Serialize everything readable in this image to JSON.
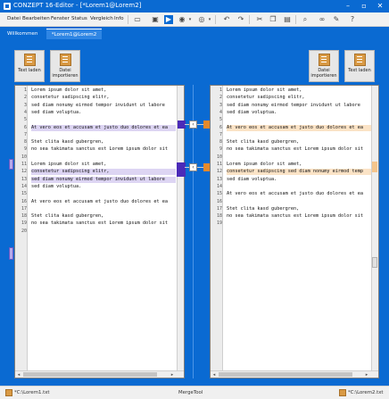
{
  "window": {
    "title": "CONZEPT 16-Editor - [*Lorem1@Lorem2]"
  },
  "menu": {
    "items": [
      "Datei",
      "Bearbeiten",
      "Fenster",
      "Status",
      "Vergleich",
      "Info"
    ]
  },
  "tabs": [
    {
      "label": "Willkommen"
    },
    {
      "label": "*Lorem1@Lorem2"
    }
  ],
  "buttons": {
    "left_load": "Text laden",
    "left_import": "Datei importieren",
    "right_import": "Datei importieren",
    "right_load": "Text laden"
  },
  "left_panel": {
    "line_numbers": [
      "1",
      "2",
      "3",
      "4",
      "5",
      "6",
      "7",
      "8",
      "9",
      "10",
      "11",
      "12",
      "13",
      "14",
      "15",
      "16",
      "17",
      "18",
      "19",
      "20"
    ],
    "lines": [
      {
        "no": 1,
        "text": "Lorem ipsum dolor sit amet,",
        "hl": ""
      },
      {
        "no": 2,
        "text": "consetetur sadipscing elitr,",
        "hl": ""
      },
      {
        "no": 3,
        "text": "sed diam nonumy eirmod tempor invidunt ut labore",
        "hl": ""
      },
      {
        "no": 4,
        "text": "sed diam voluptua.",
        "hl": ""
      },
      {
        "no": 5,
        "text": "",
        "hl": ""
      },
      {
        "no": 6,
        "text": "At vero eos et accusam et justo duo dolores et ea",
        "hl": "purple"
      },
      {
        "no": 7,
        "text": "",
        "hl": ""
      },
      {
        "no": 8,
        "text": "Stet clita kasd gubergren,",
        "hl": ""
      },
      {
        "no": 9,
        "text": "no sea takimata sanctus est Lorem ipsum dolor sit",
        "hl": ""
      },
      {
        "no": 10,
        "text": "",
        "hl": ""
      },
      {
        "no": 11,
        "text": "Lorem ipsum dolor sit amet,",
        "hl": ""
      },
      {
        "no": 12,
        "text": "consetetur sadipscing elitr,",
        "hl": "purple"
      },
      {
        "no": 13,
        "text": "sed diam nonumy eirmod tempor invidunt ut labore",
        "hl": "purple"
      },
      {
        "no": 14,
        "text": "sed diam voluptua.",
        "hl": ""
      },
      {
        "no": 15,
        "text": "",
        "hl": ""
      },
      {
        "no": 16,
        "text": "At vero eos et accusam et justo duo dolores et ea",
        "hl": ""
      },
      {
        "no": 17,
        "text": "",
        "hl": ""
      },
      {
        "no": 18,
        "text": "Stet clita kasd gubergren,",
        "hl": ""
      },
      {
        "no": 19,
        "text": "no sea takimata sanctus est Lorem ipsum dolor sit",
        "hl": ""
      },
      {
        "no": 20,
        "text": "",
        "hl": ""
      }
    ]
  },
  "right_panel": {
    "lines": [
      {
        "no": 1,
        "text": "Lorem ipsum dolor sit amet,",
        "hl": ""
      },
      {
        "no": 2,
        "text": "consetetur sadipscing elitr,",
        "hl": ""
      },
      {
        "no": 3,
        "text": "sed diam nonumy eirmod tempor invidunt ut labore",
        "hl": ""
      },
      {
        "no": 4,
        "text": "sed diam voluptua.",
        "hl": ""
      },
      {
        "no": 5,
        "text": "",
        "hl": ""
      },
      {
        "no": 6,
        "text": "At vero eos et accusam et justo duo dolores et ea",
        "hl": "orange"
      },
      {
        "no": 7,
        "text": "",
        "hl": ""
      },
      {
        "no": 8,
        "text": "Stet clita kasd gubergren,",
        "hl": ""
      },
      {
        "no": 9,
        "text": "no sea takimata sanctus est Lorem ipsum dolor sit",
        "hl": ""
      },
      {
        "no": 10,
        "text": "",
        "hl": ""
      },
      {
        "no": 11,
        "text": "Lorem ipsum dolor sit amet,",
        "hl": ""
      },
      {
        "no": 12,
        "text": "consetetur sadipscing sed diam nonumy eirmod temp",
        "hl": "orange"
      },
      {
        "no": 13,
        "text": "sed diam voluptua.",
        "hl": ""
      },
      {
        "no": 14,
        "text": "",
        "hl": ""
      },
      {
        "no": 15,
        "text": "At vero eos et accusam et justo duo dolores et ea",
        "hl": ""
      },
      {
        "no": 16,
        "text": "",
        "hl": ""
      },
      {
        "no": 17,
        "text": "Stet clita kasd gubergren,",
        "hl": ""
      },
      {
        "no": 18,
        "text": "no sea takimata sanctus est Lorem ipsum dolor sit",
        "hl": ""
      },
      {
        "no": 19,
        "text": "",
        "hl": ""
      }
    ]
  },
  "status": {
    "left_file": "*C:\\Lorem1.txt",
    "center": "MergeTool",
    "right_file": "*C:\\Lorem2.txt"
  },
  "colors": {
    "brand_blue": "#0a6ad2",
    "diff_purple": "#ddd5f3",
    "diff_orange": "#fbe3c6"
  }
}
